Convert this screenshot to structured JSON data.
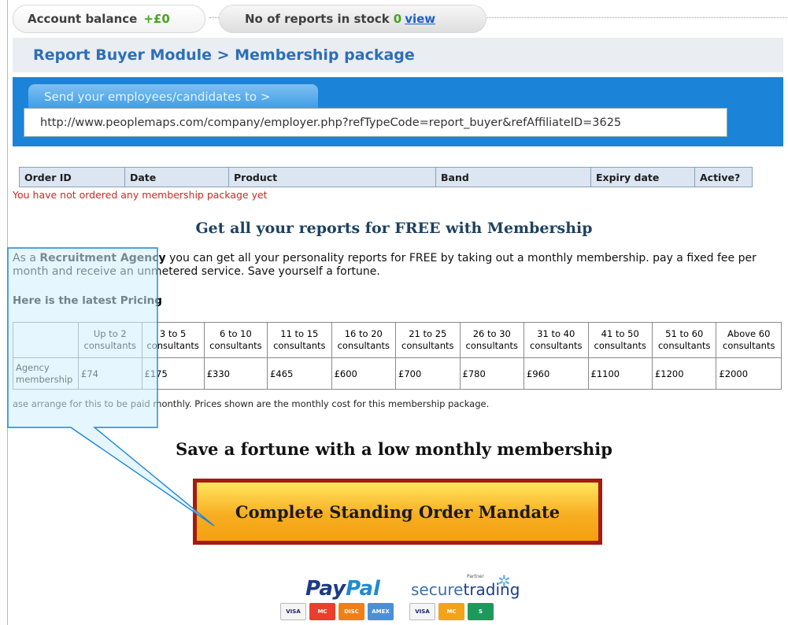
{
  "account": {
    "balance_label": "Account balance",
    "balance_value": "+£0",
    "stock_label": "No of reports in stock",
    "stock_value": "0",
    "stock_link": "view"
  },
  "breadcrumb": "Report Buyer Module > Membership package",
  "referral": {
    "tab_label": "Send your employees/candidates to >",
    "url": "http://www.peoplemaps.com/company/employer.php?refTypeCode=report_buyer&refAffiliateID=3625"
  },
  "orders": {
    "columns": [
      "Order ID",
      "Date",
      "Product",
      "Band",
      "Expiry date",
      "Active?"
    ],
    "empty_message": "You have not ordered any membership package yet"
  },
  "promo": {
    "heading": "Get all your reports for FREE with Membership",
    "intro_before": "As a ",
    "intro_bold": "Recruitment Agency",
    "intro_after": " you can get all your personality reports for FREE by taking out a monthly membership. pay a fixed fee per month and receive an unmetered service. Save yourself a fortune.",
    "pricing_heading": "Here is the latest Pricing"
  },
  "pricing": {
    "bands": [
      "Up to 2 consultants",
      "3 to 5 consultants",
      "6 to 10 consultants",
      "11 to 15 consultants",
      "16 to 20 consultants",
      "21 to 25 consultants",
      "26 to 30 consultants",
      "31 to 40 consultants",
      "41 to 50 consultants",
      "51 to 60 consultants",
      "Above 60 consultants"
    ],
    "row_label": "Agency membership",
    "prices": [
      "£74",
      "£175",
      "£330",
      "£465",
      "£600",
      "£700",
      "£780",
      "£960",
      "£1100",
      "£1200",
      "£2000"
    ],
    "note": "ase arrange for this to be paid monthly. Prices shown are the monthly cost for this membership package."
  },
  "save_heading": "Save a fortune with a low monthly membership",
  "cta_label": "Complete Standing Order Mandate",
  "payment": {
    "paypal_1": "Pay",
    "paypal_2": "Pal",
    "securetrading_1": "secure",
    "securetrading_2": "trading",
    "partner": "Partner",
    "cards": [
      "VISA",
      "MC",
      "DISC",
      "AMEX",
      "VISA",
      "MC",
      "S"
    ]
  },
  "colors": {
    "accent": "#2d6fb7",
    "panel": "#1b84d9",
    "cta": "#f8ae22",
    "cta_border": "#a31b11",
    "error": "#cc2a2a"
  }
}
